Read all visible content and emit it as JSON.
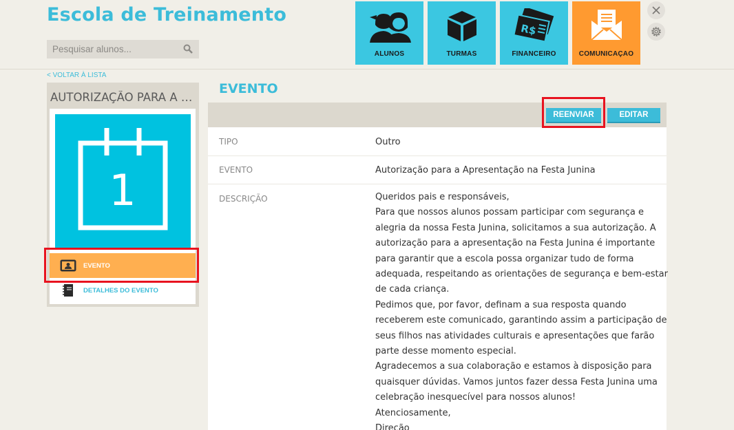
{
  "app": {
    "title": "Escola de Treinamento"
  },
  "search": {
    "placeholder": "Pesquisar alunos..."
  },
  "nav": [
    {
      "label": "ALUNOS",
      "icon": "students-icon"
    },
    {
      "label": "TURMAS",
      "icon": "box-icon"
    },
    {
      "label": "FINANCEIRO",
      "icon": "money-icon"
    },
    {
      "label": "COMUNICAÇAO",
      "icon": "envelope-icon",
      "active": true
    }
  ],
  "window_controls": {
    "close": "close-icon",
    "settings": "gear-icon"
  },
  "back_link": "< VOLTAR À LISTA",
  "sidebar": {
    "title": "AUTORIZAÇÃO PARA A APRESENTAÇÃO NA FESTA JUNINA",
    "calendar_day": "1",
    "items": [
      {
        "label": "EVENTO",
        "icon": "user-card-icon",
        "active": true
      },
      {
        "label": "DETALHES DO EVENTO",
        "icon": "notebook-icon"
      }
    ]
  },
  "content": {
    "title": "EVENTO",
    "buttons": {
      "resend": "REENVIAR",
      "edit": "EDITAR"
    },
    "fields": {
      "tipo": {
        "label": "TIPO",
        "value": "Outro"
      },
      "evento": {
        "label": "EVENTO",
        "value": "Autorização para a Apresentação na Festa Junina"
      },
      "descricao": {
        "label": "DESCRIÇÃO",
        "lines": [
          "Queridos pais e responsáveis,",
          "Para que nossos alunos possam participar com segurança e",
          "alegria da nossa Festa Junina, solicitamos a sua autorização. A",
          "autorização para a apresentação na Festa Junina é importante",
          "para garantir que a escola possa organizar tudo de forma",
          "adequada, respeitando as orientações de segurança e bem-estar",
          "de cada criança.",
          "Pedimos que, por favor, definam a sua resposta quando",
          "receberem este comunicado, garantindo assim a participação de",
          "seus filhos nas atividades culturais e apresentações que farão",
          "parte desse momento especial.",
          "Agradecemos a sua colaboração e estamos à disposição para",
          "quaisquer dúvidas. Vamos juntos fazer dessa Festa Junina uma",
          "celebração inesquecível para nossos alunos!",
          "Atenciosamente,",
          "Direção"
        ]
      }
    }
  },
  "colors": {
    "accent": "#3cbcd9",
    "active": "#ff9a30",
    "highlight": "#e8131f"
  }
}
